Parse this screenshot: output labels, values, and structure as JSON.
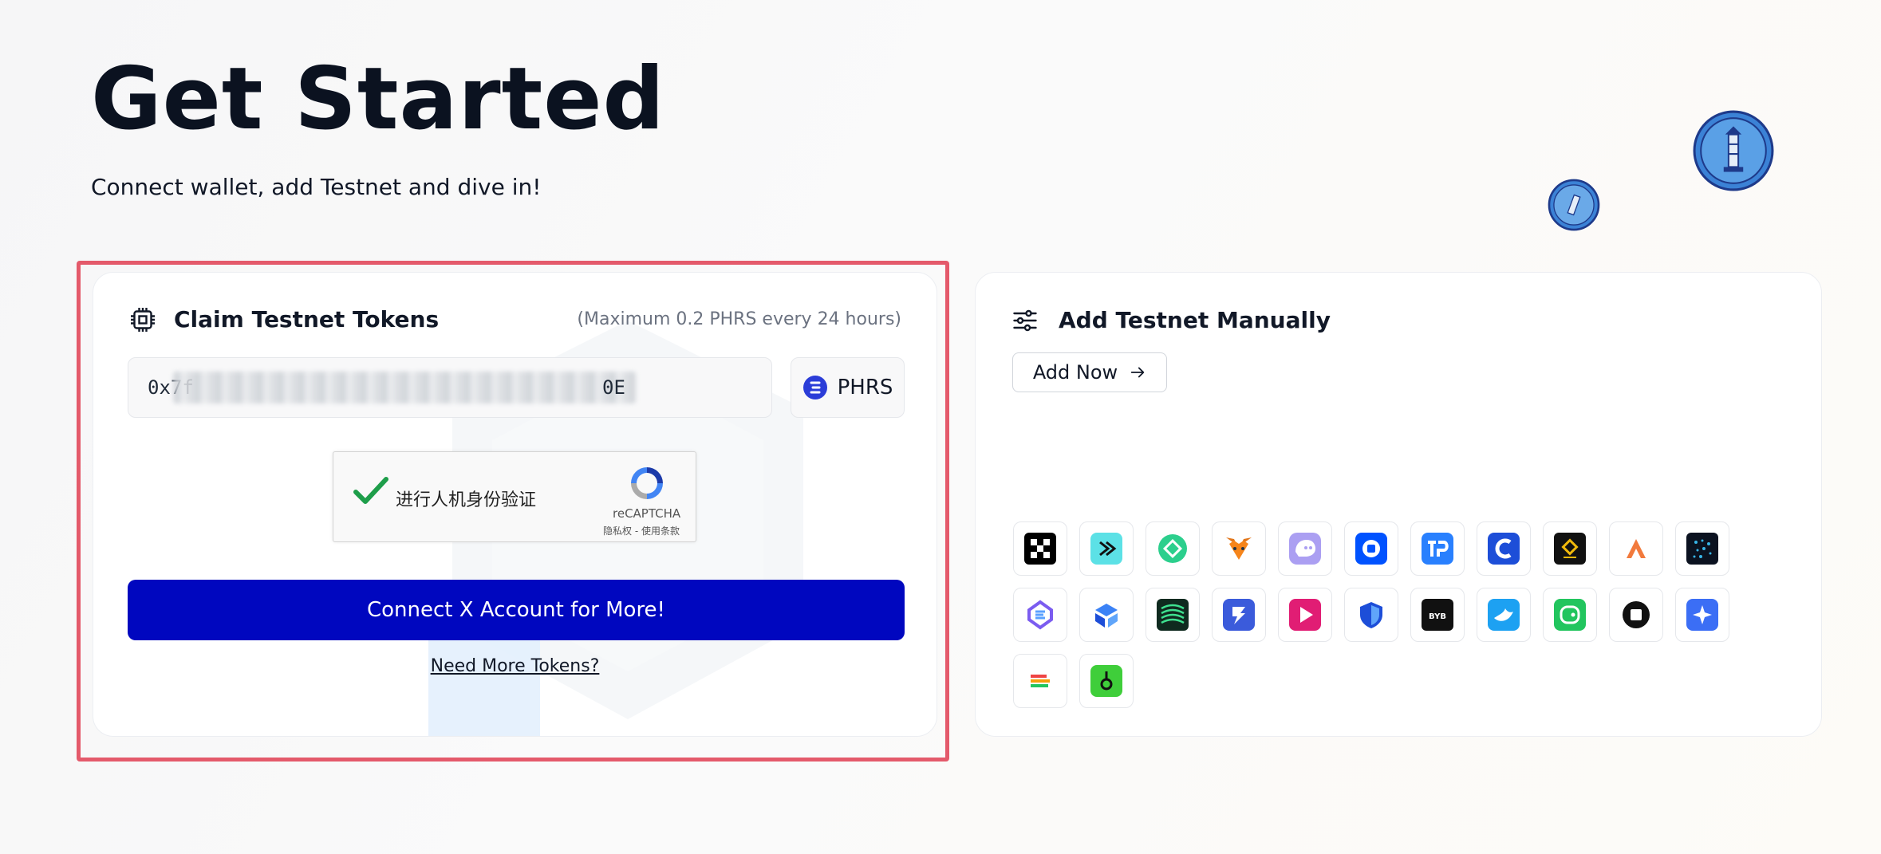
{
  "header": {
    "title": "Get Started",
    "subtitle": "Connect wallet, add Testnet and dive in!"
  },
  "claim": {
    "title": "Claim Testnet Tokens",
    "limit_note": "(Maximum 0.2 PHRS every 24 hours)",
    "address_prefix": "0x7f",
    "address_suffix": "0E",
    "token_label": "PHRS",
    "captcha": {
      "label": "进行人机身份验证",
      "brand": "reCAPTCHA",
      "terms": "隐私权 - 使用条款"
    },
    "connect_button": "Connect X Account for More!",
    "more_tokens_link": "Need More Tokens?"
  },
  "manual": {
    "title": "Add Testnet Manually",
    "add_now_button": "Add Now"
  },
  "colors": {
    "primary_button": "#0007bf",
    "highlight_border": "#e45a6b"
  },
  "wallets": [
    {
      "name": "okx-wallet-icon"
    },
    {
      "name": "bitget-wallet-icon"
    },
    {
      "name": "bitverse-wallet-icon"
    },
    {
      "name": "metamask-icon"
    },
    {
      "name": "phantom-icon"
    },
    {
      "name": "coinbase-wallet-icon"
    },
    {
      "name": "tokenpocket-icon"
    },
    {
      "name": "cyber-wallet-icon"
    },
    {
      "name": "binance-wallet-icon"
    },
    {
      "name": "aptos-wallet-icon"
    },
    {
      "name": "particle-wallet-icon"
    },
    {
      "name": "ethereum-wallet-icon"
    },
    {
      "name": "blockchain-wallet-icon"
    },
    {
      "name": "stripe-wallet-icon"
    },
    {
      "name": "flash-wallet-icon"
    },
    {
      "name": "play-wallet-icon"
    },
    {
      "name": "shield-wallet-icon"
    },
    {
      "name": "bybit-wallet-icon"
    },
    {
      "name": "bird-wallet-icon"
    },
    {
      "name": "chat-wallet-icon"
    },
    {
      "name": "square-wallet-icon"
    },
    {
      "name": "sparkle-wallet-icon"
    },
    {
      "name": "lines-wallet-icon"
    },
    {
      "name": "key-wallet-icon"
    }
  ]
}
